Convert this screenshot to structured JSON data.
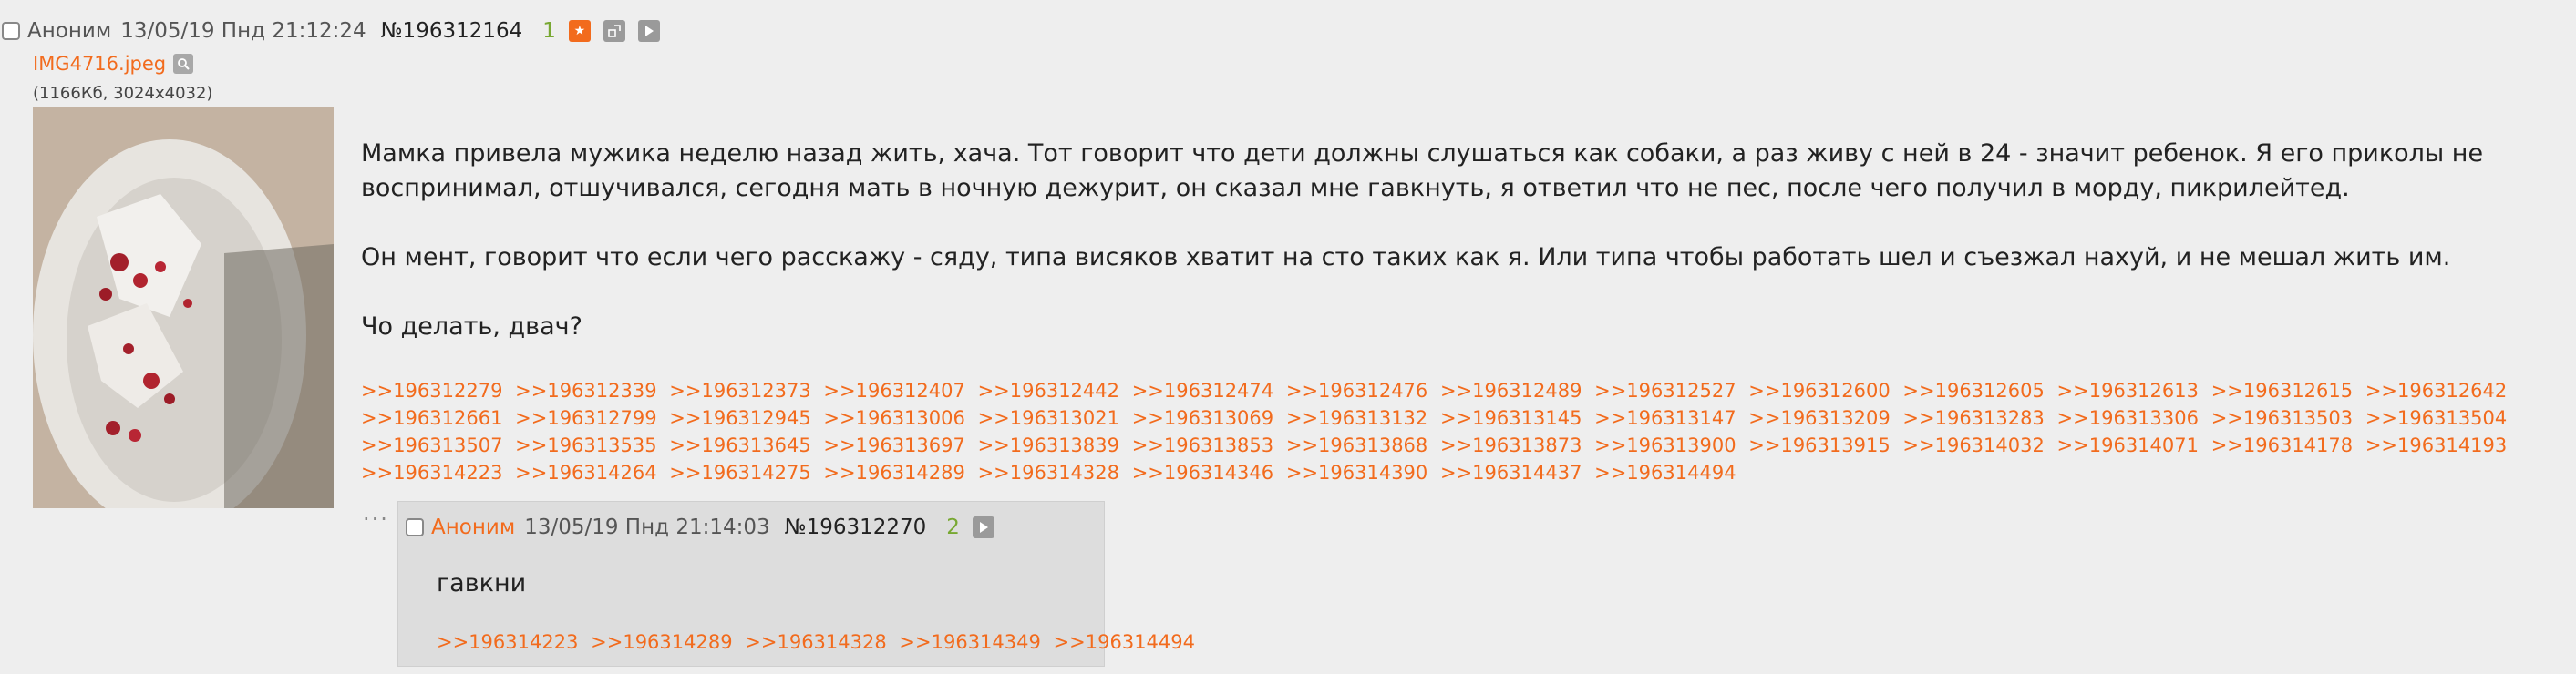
{
  "op": {
    "author": "Аноним",
    "date": "13/05/19 Пнд 21:12:24",
    "number": "№196312164",
    "reply_count": "1",
    "file": {
      "name": "IMG4716.jpeg",
      "meta": "(1166Кб, 3024x4032)"
    },
    "paragraphs": [
      "Мамка привела мужика неделю назад жить, хача. Тот говорит что дети должны слушаться как собаки, а раз живу с ней в 24 - значит ребенок. Я его приколы не воспринимал, отшучивался, сегодня мать в ночную дежурит, он сказал мне гавкнуть, я ответил что не пес, после чего получил в морду, пикрилейтед.",
      "Он мент, говорит что если чего расскажу - сяду, типа висяков хватит на сто таких как я. Или типа чтобы работать шел и съезжал нахуй, и не мешал жить им.",
      "Чо делать, двач?"
    ],
    "backlinks": [
      ">>196312279",
      ">>196312339",
      ">>196312373",
      ">>196312407",
      ">>196312442",
      ">>196312474",
      ">>196312476",
      ">>196312489",
      ">>196312527",
      ">>196312600",
      ">>196312605",
      ">>196312613",
      ">>196312615",
      ">>196312642",
      ">>196312661",
      ">>196312799",
      ">>196312945",
      ">>196313006",
      ">>196313021",
      ">>196313069",
      ">>196313132",
      ">>196313145",
      ">>196313147",
      ">>196313209",
      ">>196313283",
      ">>196313306",
      ">>196313503",
      ">>196313504",
      ">>196313507",
      ">>196313535",
      ">>196313645",
      ">>196313697",
      ">>196313839",
      ">>196313853",
      ">>196313868",
      ">>196313873",
      ">>196313900",
      ">>196313915",
      ">>196314032",
      ">>196314071",
      ">>196314178",
      ">>196314193",
      ">>196314223",
      ">>196314264",
      ">>196314275",
      ">>196314289",
      ">>196314328",
      ">>196314346",
      ">>196314390",
      ">>196314437",
      ">>196314494"
    ]
  },
  "reply": {
    "dots": "···",
    "author": "Аноним",
    "date": "13/05/19 Пнд 21:14:03",
    "number": "№196312270",
    "reply_count": "2",
    "body": "гавкни",
    "backlinks": [
      ">>196314223",
      ">>196314289",
      ">>196314328",
      ">>196314349",
      ">>196314494"
    ]
  },
  "icons": {
    "star": "star-icon",
    "expand": "expand-icon",
    "play": "play-icon",
    "zoom": "magnifier-icon"
  },
  "colors": {
    "accent": "#f26b1d",
    "reply_count": "#78a832",
    "background": "#eeeeee",
    "reply_background": "#dddddd"
  }
}
